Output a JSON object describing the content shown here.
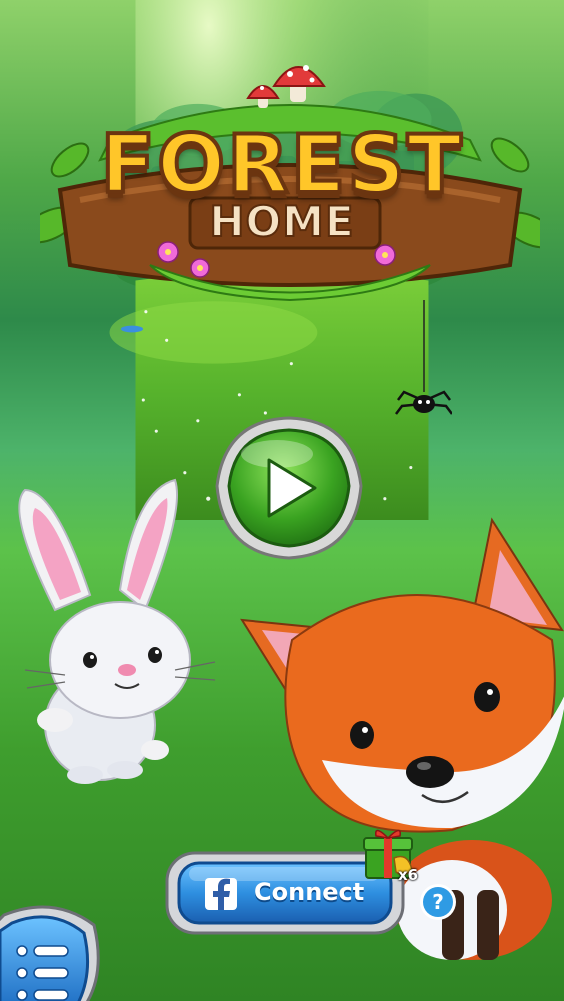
{
  "logo": {
    "title": "FOREST",
    "subtitle": "HOME"
  },
  "play": {
    "icon": "play-icon"
  },
  "connect": {
    "label": "Connect",
    "icon": "facebook-icon"
  },
  "gift": {
    "count": "x6",
    "icon": "gift-icon"
  },
  "help": {
    "label": "?"
  },
  "menu": {
    "icon": "menu-list-icon"
  },
  "colors": {
    "play_green": "#3aa321",
    "connect_blue": "#2e8fe0",
    "logo_gold": "#ffc629",
    "wood": "#8a4a1c"
  }
}
